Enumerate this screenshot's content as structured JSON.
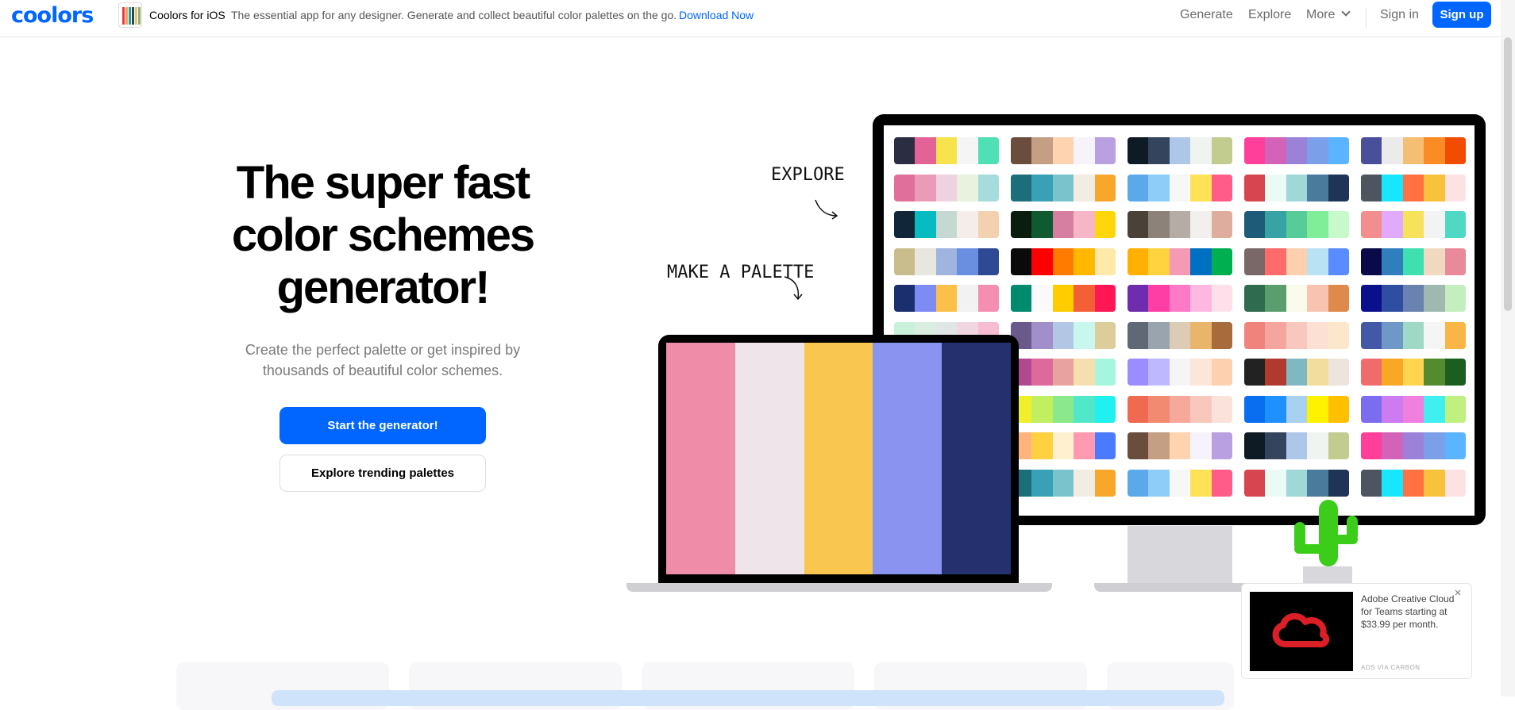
{
  "header": {
    "logo": "coolors",
    "promo": {
      "title": "Coolors for iOS",
      "description": "The essential app for any designer. Generate and collect beautiful color palettes on the go.",
      "link": "Download Now"
    },
    "nav": {
      "generate": "Generate",
      "explore": "Explore",
      "more": "More",
      "signin": "Sign in",
      "signup": "Sign up"
    }
  },
  "hero": {
    "title_lines": [
      "The super fast",
      "color schemes",
      "generator!"
    ],
    "subtitle_lines": [
      "Create the perfect palette or get inspired by",
      "thousands of beautiful color schemes."
    ],
    "primary_button": "Start the generator!",
    "secondary_button": "Explore trending palettes"
  },
  "illustration": {
    "explore_label": "EXPLORE",
    "make_palette_label": "MAKE A PALETTE",
    "laptop_palette": [
      "#ef8ca8",
      "#efe4ea",
      "#f9c74f",
      "#8a93f0",
      "#24316e"
    ],
    "monitor_palettes": [
      [
        "#2b2d42",
        "#e36397",
        "#f7e34b",
        "#f5f5f5",
        "#4fe0b6"
      ],
      [
        "#6b4d3e",
        "#c59f84",
        "#fed4b0",
        "#f7f3fa",
        "#b9a0e0"
      ],
      [
        "#0f1b24",
        "#34445c",
        "#aec6e8",
        "#f0f4f0",
        "#c2cc8f"
      ],
      [
        "#ff3f9a",
        "#d263b8",
        "#9b82d8",
        "#7b9fe8",
        "#5ab4ff"
      ],
      [
        "#4a4f9a",
        "#ebebeb",
        "#f5bf73",
        "#fb8b24",
        "#f24c00"
      ],
      [
        "#e0709b",
        "#e99bb8",
        "#edd2e0",
        "#e9f1df",
        "#a6dcdc"
      ],
      [
        "#1b6e7a",
        "#3aa0b5",
        "#7ac2cc",
        "#f2ede2",
        "#f9a72b"
      ],
      [
        "#5ca9e9",
        "#8ecdf7",
        "#f7f7f7",
        "#ffe255",
        "#ff5c8a"
      ],
      [
        "#d64550",
        "#eafbf5",
        "#a0d8d8",
        "#4a7b9d",
        "#1e3557"
      ],
      [
        "#4f5560",
        "#18e6ff",
        "#ff7043",
        "#f9c23c",
        "#fde2e4"
      ],
      [
        "#12263a",
        "#06bcc1",
        "#c5d8d1",
        "#f4edea",
        "#f4d1ae"
      ],
      [
        "#0b1d0f",
        "#0f5a31",
        "#d77fa1",
        "#f7b5c8",
        "#ffd60a"
      ],
      [
        "#4a4238",
        "#8c827a",
        "#b5aca6",
        "#f2f0ed",
        "#dfad9e"
      ],
      [
        "#1d5b79",
        "#38a3a5",
        "#57cc99",
        "#80ed99",
        "#c7f9cc"
      ],
      [
        "#f28e8e",
        "#e0aaff",
        "#f7e35b",
        "#f3f3f3",
        "#4fd8c4"
      ],
      [
        "#c9bd8e",
        "#e7e6df",
        "#9fb4df",
        "#6a8fe0",
        "#2d4a93"
      ],
      [
        "#0a0a0a",
        "#ff0000",
        "#ff7b00",
        "#ffb700",
        "#fee9a8"
      ],
      [
        "#ffb000",
        "#ffd23f",
        "#f59ab5",
        "#0070c0",
        "#00b050"
      ],
      [
        "#7a6868",
        "#ff6b6b",
        "#ffd0b0",
        "#b9e2f5",
        "#5b8cff"
      ],
      [
        "#0a0a4a",
        "#2f7fbf",
        "#3ee0b0",
        "#f0d9c0",
        "#e98a9a"
      ],
      [
        "#1b2f6e",
        "#7d8cf2",
        "#fcbf49",
        "#f2f2f2",
        "#f48fb1"
      ],
      [
        "#008b6e",
        "#fafafa",
        "#ffcc00",
        "#f46036",
        "#ff1654"
      ],
      [
        "#6d2dae",
        "#ff3ea5",
        "#ff7ac6",
        "#ffb8e0",
        "#ffe0ea"
      ],
      [
        "#2f6b4f",
        "#5a9e6f",
        "#fafbea",
        "#f8c3b0",
        "#dd8a4a"
      ],
      [
        "#0a0f8c",
        "#2f4ea1",
        "#6a82b0",
        "#9fb8b0",
        "#c5eec0"
      ],
      [
        "#c8f0da",
        "#d9eee1",
        "#e0e6e6",
        "#f0d6e0",
        "#f7bcd1"
      ],
      [
        "#6a5a8c",
        "#a08fc8",
        "#b3c6e3",
        "#c8f7ee",
        "#dccd9b"
      ],
      [
        "#606875",
        "#9aa4ae",
        "#dccbb5",
        "#e9b56a",
        "#a86b3c"
      ],
      [
        "#f0837c",
        "#f4a59e",
        "#f8c8bf",
        "#fbe0d3",
        "#fde7cc"
      ],
      [
        "#4458a8",
        "#6f97c8",
        "#9fd8c4",
        "#f5f5f5",
        "#f9b545"
      ],
      [
        "#f06b6b",
        "#e99595",
        "#d4b2b2",
        "#b6d2d6",
        "#8ff0f0"
      ],
      [
        "#b04a8f",
        "#de6a9d",
        "#e8a3a0",
        "#f5deb0",
        "#a6f5de"
      ],
      [
        "#9b8cff",
        "#bdb8ff",
        "#f5f5f5",
        "#fde6d9",
        "#fdd0b0"
      ],
      [
        "#222222",
        "#b03a2e",
        "#7fb8c0",
        "#f2dc9e",
        "#ede4db"
      ],
      [
        "#f06b6b",
        "#f9a826",
        "#ffd54f",
        "#558b2f",
        "#1b5e20"
      ],
      [
        "#000000",
        "#2962ff",
        "#d32f2f",
        "#f9b233",
        "#e0e0e0"
      ],
      [
        "#f0f02a",
        "#c0f060",
        "#8ce88c",
        "#50e8c8",
        "#20f0f0"
      ],
      [
        "#ef6a50",
        "#f28a72",
        "#f6a89a",
        "#f9c8bd",
        "#fbe3dc"
      ],
      [
        "#0a6ef0",
        "#1e90ff",
        "#a8d0f0",
        "#fff200",
        "#ffc000"
      ],
      [
        "#7b6cf0",
        "#cc7cf0",
        "#f080e0",
        "#40f0f0",
        "#c0f080"
      ],
      [
        "#0a28a0",
        "#5a4ae0",
        "#9a70e0",
        "#e89aa0",
        "#f06aa0"
      ],
      [
        "#ffb480",
        "#ffd040",
        "#fff0d0",
        "#ff9ab0",
        "#4a7bff"
      ],
      [
        "#6b4d3e",
        "#c59f84",
        "#fed4b0",
        "#f7f3fa",
        "#b9a0e0"
      ],
      [
        "#0f1b24",
        "#34445c",
        "#aec6e8",
        "#f0f4f0",
        "#c2cc8f"
      ],
      [
        "#ff3f9a",
        "#d263b8",
        "#9b82d8",
        "#7b9fe8",
        "#5ab4ff"
      ],
      [
        "#4a4f9a",
        "#ebebeb",
        "#f5bf73",
        "#fb8b24",
        "#f24c00"
      ],
      [
        "#1b6e7a",
        "#3aa0b5",
        "#7ac2cc",
        "#f2ede2",
        "#f9a72b"
      ],
      [
        "#5ca9e9",
        "#8ecdf7",
        "#f7f7f7",
        "#ffe255",
        "#ff5c8a"
      ],
      [
        "#d64550",
        "#eafbf5",
        "#a0d8d8",
        "#4a7b9d",
        "#1e3557"
      ],
      [
        "#4f5560",
        "#18e6ff",
        "#ff7043",
        "#f9c23c",
        "#fde2e4"
      ]
    ]
  },
  "ad": {
    "text": "Adobe Creative Cloud for Teams starting at $33.99 per month.",
    "via": "ADS VIA CARBON",
    "close": "×"
  },
  "colors": {
    "brand": "#0066ff",
    "cactus": "#3ccc1a"
  }
}
